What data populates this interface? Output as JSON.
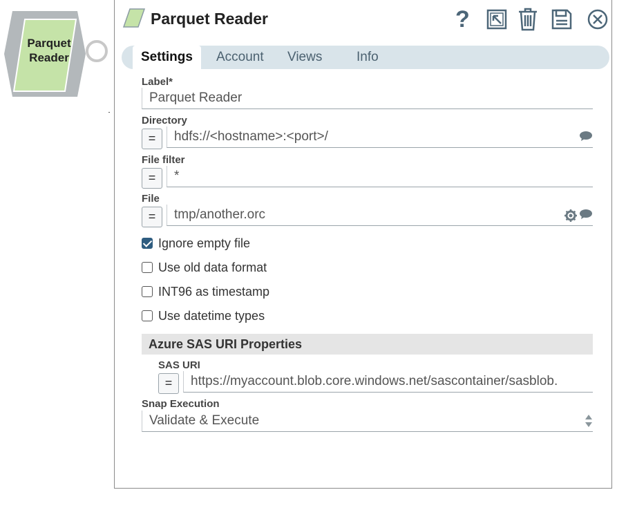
{
  "canvas": {
    "snap_label": "Parquet Reader"
  },
  "dialog": {
    "title": "Parquet Reader",
    "toolbar": {
      "help": "help-icon",
      "export": "export-icon",
      "delete": "trash-icon",
      "save": "save-icon",
      "close": "close-icon"
    },
    "tabs": [
      {
        "label": "Settings",
        "active": true
      },
      {
        "label": "Account",
        "active": false
      },
      {
        "label": "Views",
        "active": false
      },
      {
        "label": "Info",
        "active": false
      }
    ],
    "fields": {
      "label": {
        "label": "Label*",
        "value": "Parquet Reader"
      },
      "directory": {
        "label": "Directory",
        "value": "hdfs://<hostname>:<port>/",
        "expr": "="
      },
      "file_filter": {
        "label": "File filter",
        "value": "*",
        "expr": "="
      },
      "file": {
        "label": "File",
        "value": "tmp/another.orc",
        "expr": "="
      }
    },
    "checkboxes": [
      {
        "label": "Ignore empty file",
        "checked": true
      },
      {
        "label": "Use old data format",
        "checked": false
      },
      {
        "label": "INT96 as timestamp",
        "checked": false
      },
      {
        "label": "Use datetime types",
        "checked": false
      }
    ],
    "azure_section": {
      "title": "Azure SAS URI Properties",
      "sas_uri": {
        "label": "SAS URI",
        "value": "https://myaccount.blob.core.windows.net/sascontainer/sasblob.",
        "expr": "="
      }
    },
    "snap_execution": {
      "label": "Snap Execution",
      "value": "Validate & Execute"
    }
  },
  "colors": {
    "snap_fill": "#c5e3a8",
    "snap_border": "#b3b8bb",
    "tab_bar": "#d9e4ea",
    "icon": "#4c6678"
  }
}
